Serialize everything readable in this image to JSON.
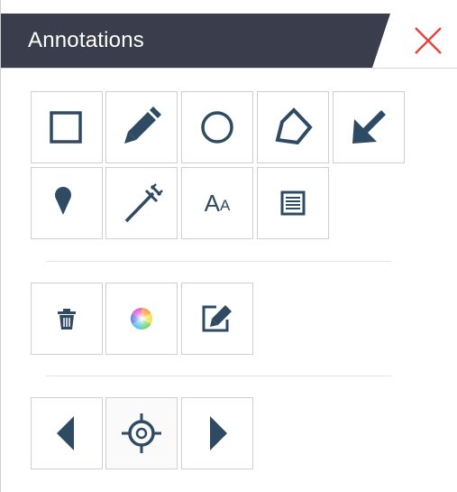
{
  "panel": {
    "title": "Annotations",
    "close_icon": "close-icon",
    "colors": {
      "header_bg": "#3a3d4c",
      "icon": "#2f4a63",
      "close": "#e8403a"
    }
  },
  "tools": {
    "row1": [
      "rectangle-icon",
      "pencil-icon",
      "circle-icon",
      "polygon-icon",
      "arrow-icon"
    ],
    "row2": [
      "pin-icon",
      "measure-icon",
      "text-size-icon",
      "note-icon"
    ],
    "text_tool_label": {
      "big": "A",
      "small": "A"
    }
  },
  "actions": [
    "trash-icon",
    "color-wheel-icon",
    "edit-icon"
  ],
  "navigation": [
    "previous-icon",
    "locate-icon",
    "next-icon"
  ]
}
